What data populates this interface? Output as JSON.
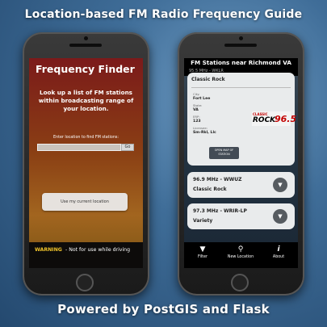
{
  "banner": {
    "top": "Location-based FM Radio Frequency Guide",
    "bottom": "Powered by PostGIS and Flask"
  },
  "left_phone": {
    "title": "Frequency Finder",
    "description": "Look up a list of FM stations within broadcasting range of your location.",
    "location_label": "Enter location to find FM stations:",
    "location_input_value": "",
    "go_label": "Go",
    "current_location_label": "Use my current location",
    "warning_heading": "WARNING",
    "warning_text": "- Not for use while driving"
  },
  "right_phone": {
    "header": "FM Stations near Richmond VA",
    "subheader": "95.5 MHz - WKLR",
    "card1": {
      "genre": "Classic Rock",
      "city_key": "City:",
      "city_val": "Fort Lee",
      "state_key": "State:",
      "state_val": "VA",
      "erp_key": "ERP:",
      "erp_val": "123",
      "license_key": "Licensee:",
      "license_val": "Sm-Rkl, Llc",
      "logo_a": "CLASSIC",
      "logo_b": "ROCK",
      "logo_c": "96.5",
      "map_button": "OPEN MAP OF STATION"
    },
    "stations": [
      {
        "freq": "96.9 MHz - WWUZ",
        "genre": "Classic Rock"
      },
      {
        "freq": "97.3 MHz - WRIR-LP",
        "genre": "Variety"
      }
    ],
    "tabs": [
      {
        "label": "Filter",
        "icon": "filter-icon",
        "glyph": "▼"
      },
      {
        "label": "New Location",
        "icon": "search-icon",
        "glyph": "⚲"
      },
      {
        "label": "About",
        "icon": "info-icon",
        "glyph": "i"
      }
    ],
    "chevron_glyph": "▼"
  }
}
